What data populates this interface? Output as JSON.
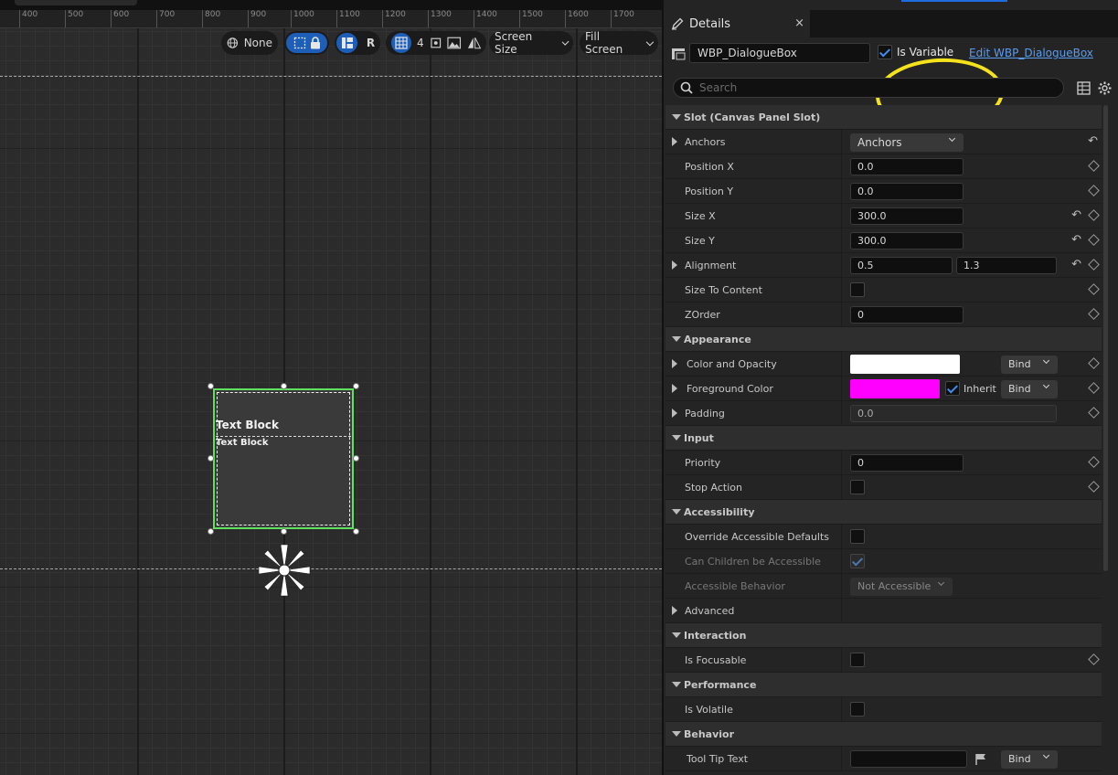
{
  "ruler": {
    "ticks": [
      "400",
      "500",
      "600",
      "700",
      "800",
      "900",
      "1000",
      "1100",
      "1200",
      "1300",
      "1400",
      "1500",
      "1600",
      "1700"
    ]
  },
  "toolbar": {
    "dpi_label": "None",
    "r_label": "R",
    "grid_snap": "4",
    "screen_size": "Screen Size",
    "fill_screen": "Fill Screen"
  },
  "canvas": {
    "widget_title": "Text Block",
    "widget_subtext": "Text Block",
    "selection_color": "#5fe05f"
  },
  "details": {
    "tab_label": "Details",
    "close_glyph": "×",
    "widget_name": "WBP_DialogueBox",
    "is_variable_label": "Is Variable",
    "is_variable_checked": true,
    "edit_link": "Edit WBP_DialogueBox",
    "search_placeholder": "Search",
    "highlight_color": "#f5e21c",
    "accent_color": "#1e6de0"
  },
  "sections": {
    "slot": {
      "title": "Slot (Canvas Panel Slot)",
      "anchors_label": "Anchors",
      "anchors_value": "Anchors",
      "pos_x_label": "Position X",
      "pos_x": "0.0",
      "pos_y_label": "Position Y",
      "pos_y": "0.0",
      "size_x_label": "Size X",
      "size_x": "300.0",
      "size_y_label": "Size Y",
      "size_y": "300.0",
      "alignment_label": "Alignment",
      "align_x": "0.5",
      "align_y": "1.3",
      "size_to_content_label": "Size To Content",
      "zorder_label": "ZOrder",
      "zorder": "0"
    },
    "appearance": {
      "title": "Appearance",
      "color_opacity_label": "Color and Opacity",
      "color_opacity_value": "#ffffff",
      "foreground_label": "Foreground Color",
      "foreground_value": "#ff00ff",
      "inherit_label": "Inherit",
      "bind_label": "Bind",
      "padding_label": "Padding",
      "padding_value": "0.0"
    },
    "input": {
      "title": "Input",
      "priority_label": "Priority",
      "priority": "0",
      "stop_action_label": "Stop Action"
    },
    "accessibility": {
      "title": "Accessibility",
      "override_label": "Override Accessible Defaults",
      "children_label": "Can Children be Accessible",
      "behavior_label": "Accessible Behavior",
      "behavior_value": "Not Accessible",
      "advanced_label": "Advanced"
    },
    "interaction": {
      "title": "Interaction",
      "focusable_label": "Is Focusable"
    },
    "performance": {
      "title": "Performance",
      "volatile_label": "Is Volatile"
    },
    "behavior": {
      "title": "Behavior",
      "tooltip_label": "Tool Tip Text",
      "bind_label": "Bind"
    }
  }
}
